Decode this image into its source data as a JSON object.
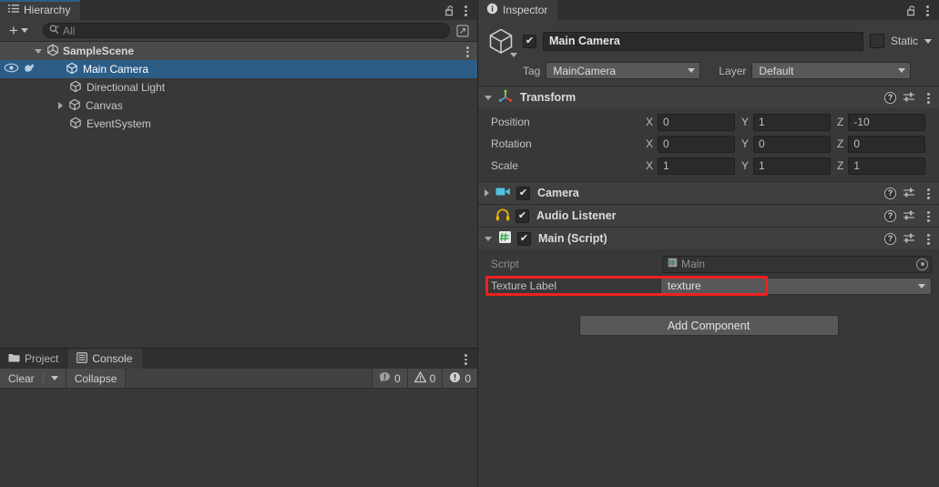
{
  "hierarchy": {
    "tab_label": "Hierarchy",
    "tab_icon": "hierarchy-list-icon",
    "lock_icon": "lock-open-icon",
    "menu_icon": "kebab-menu-icon",
    "create_label": "+",
    "search_placeholder": "All",
    "search_value": "",
    "search_icon": "search-icon",
    "pick_icon": "search-picker-icon",
    "scene": {
      "name": "SampleScene",
      "icon": "unity-scene-icon",
      "expanded": true
    },
    "items": [
      {
        "label": "Main Camera",
        "icon": "gameobject-cube-icon",
        "selected": true,
        "indent": 1,
        "expandable": false,
        "visibility_icon": "eye-icon",
        "pickability_icon": "hand-icon"
      },
      {
        "label": "Directional Light",
        "icon": "gameobject-cube-icon",
        "selected": false,
        "indent": 1,
        "expandable": false
      },
      {
        "label": "Canvas",
        "icon": "gameobject-cube-icon",
        "selected": false,
        "indent": 1,
        "expandable": true
      },
      {
        "label": "EventSystem",
        "icon": "gameobject-cube-icon",
        "selected": false,
        "indent": 1,
        "expandable": false
      }
    ]
  },
  "inspector": {
    "tab_label": "Inspector",
    "tab_icon": "info-icon",
    "lock_icon": "lock-open-icon",
    "menu_icon": "kebab-menu-icon",
    "gameobject": {
      "icon": "gameobject-cube-icon",
      "enabled": true,
      "name": "Main Camera",
      "static_label": "Static",
      "static_checked": false,
      "tag_label": "Tag",
      "tag_value": "MainCamera",
      "layer_label": "Layer",
      "layer_value": "Default"
    },
    "components": [
      {
        "name": "Transform",
        "icon": "transform-axis-icon",
        "expanded": true,
        "has_checkbox": false,
        "help_icon": "help-icon",
        "preset_icon": "preset-icon",
        "menu_icon": "kebab-menu-icon",
        "rows": [
          {
            "label": "Position",
            "fields": [
              {
                "axis": "X",
                "value": "0"
              },
              {
                "axis": "Y",
                "value": "1"
              },
              {
                "axis": "Z",
                "value": "-10"
              }
            ]
          },
          {
            "label": "Rotation",
            "fields": [
              {
                "axis": "X",
                "value": "0"
              },
              {
                "axis": "Y",
                "value": "0"
              },
              {
                "axis": "Z",
                "value": "0"
              }
            ]
          },
          {
            "label": "Scale",
            "fields": [
              {
                "axis": "X",
                "value": "1"
              },
              {
                "axis": "Y",
                "value": "1"
              },
              {
                "axis": "Z",
                "value": "1"
              }
            ]
          }
        ]
      },
      {
        "name": "Camera",
        "icon": "camera-icon",
        "expanded": false,
        "has_checkbox": true,
        "checked": true,
        "collapsed_arrow": true
      },
      {
        "name": "Audio Listener",
        "icon": "audio-listener-icon",
        "expanded": false,
        "has_checkbox": true,
        "checked": true,
        "collapsed_arrow": false
      },
      {
        "name": "Main (Script)",
        "icon": "csharp-script-icon",
        "expanded": true,
        "has_checkbox": true,
        "checked": true,
        "collapsed_arrow": true
      }
    ],
    "script_row": {
      "label": "Script",
      "value": "Main",
      "value_icon": "csharp-script-icon",
      "picker_icon": "object-picker-icon"
    },
    "texture_row": {
      "label": "Texture Label",
      "value": "texture",
      "dropdown_icon": "chevron-down-icon",
      "highlighted": true,
      "highlight_color": "#f02020"
    },
    "add_component_label": "Add Component"
  },
  "bottom_panel": {
    "tabs": [
      {
        "label": "Project",
        "icon": "folder-icon",
        "active": false
      },
      {
        "label": "Console",
        "icon": "console-icon",
        "active": true
      }
    ],
    "menu_icon": "kebab-menu-icon",
    "toolbar": {
      "clear_label": "Clear",
      "clear_dropdown_icon": "chevron-down-icon",
      "collapse_label": "Collapse",
      "counters": [
        {
          "icon": "log-icon",
          "count": "0"
        },
        {
          "icon": "warning-icon",
          "count": "0"
        },
        {
          "icon": "error-icon",
          "count": "0"
        }
      ]
    }
  },
  "colors": {
    "selection_blue": "#2c5d87",
    "panel_bg": "#383838",
    "header_bg": "#3c3c3c",
    "highlight_red": "#f02020"
  }
}
